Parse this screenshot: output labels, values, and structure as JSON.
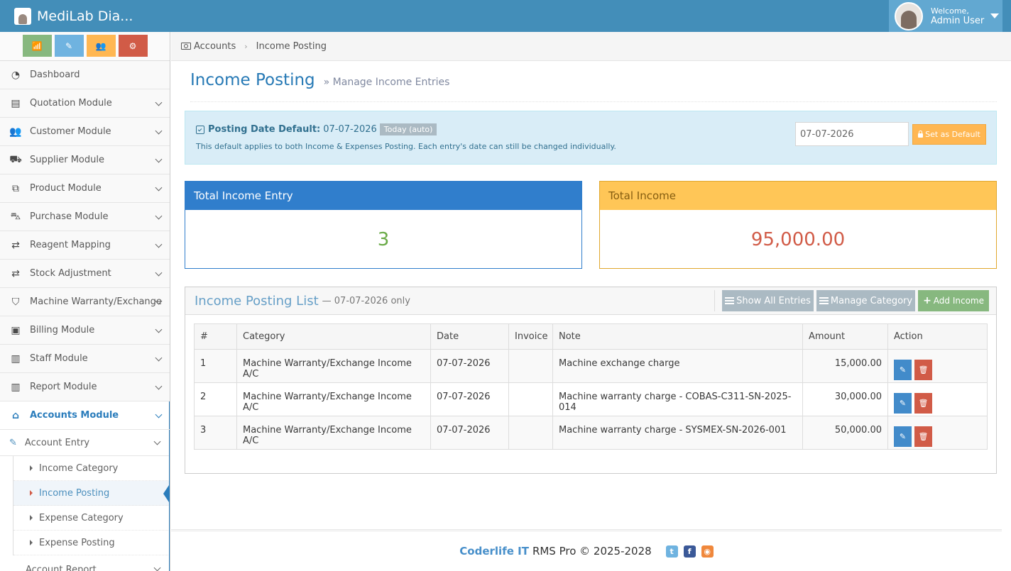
{
  "app": {
    "title": "MediLab Dia..."
  },
  "user": {
    "welcome": "Welcome,",
    "name": "Admin User"
  },
  "shortcuts": [
    {
      "icon": "signal-icon",
      "glyph": "📶"
    },
    {
      "icon": "pencil-icon",
      "glyph": "✎"
    },
    {
      "icon": "users-icon",
      "glyph": "👥"
    },
    {
      "icon": "cogs-icon",
      "glyph": "⚙"
    }
  ],
  "sidebar": {
    "items": [
      {
        "label": "Dashboard",
        "icon": "tachometer-icon",
        "glyph": "◔"
      },
      {
        "label": "Quotation Module",
        "icon": "file-icon",
        "glyph": "▤"
      },
      {
        "label": "Customer Module",
        "icon": "users-icon",
        "glyph": "👥"
      },
      {
        "label": "Supplier Module",
        "icon": "truck-icon",
        "glyph": "⛟"
      },
      {
        "label": "Product Module",
        "icon": "cubes-icon",
        "glyph": "⧉"
      },
      {
        "label": "Purchase Module",
        "icon": "shopping-cart-icon",
        "glyph": "⛍"
      },
      {
        "label": "Reagent Mapping",
        "icon": "exchange-icon",
        "glyph": "⇄"
      },
      {
        "label": "Stock Adjustment",
        "icon": "exchange-icon",
        "glyph": "⇄"
      },
      {
        "label": "Machine Warranty/Exchange",
        "icon": "shield-icon",
        "glyph": "⛉"
      },
      {
        "label": "Billing Module",
        "icon": "money-icon",
        "glyph": "▣"
      },
      {
        "label": "Staff Module",
        "icon": "briefcase-icon",
        "glyph": "▥"
      },
      {
        "label": "Report Module",
        "icon": "bar-chart-icon",
        "glyph": "▥"
      },
      {
        "label": "Accounts Module",
        "icon": "bank-icon",
        "glyph": "⌂"
      }
    ],
    "account_entry": "Account Entry",
    "account_entry_glyph": "✎",
    "sub_items": [
      "Income Category",
      "Income Posting",
      "Expense Category",
      "Expense Posting"
    ],
    "account_report": "Account Report"
  },
  "breadcrumb": {
    "root": "Accounts",
    "sep": "›",
    "current": "Income Posting"
  },
  "page": {
    "title": "Income Posting",
    "subtitle": "» Manage Income Entries"
  },
  "alert": {
    "label": "Posting Date Default:",
    "date": "07-07-2026",
    "badge": "Today (auto)",
    "note": "This default applies to both Income & Expenses Posting. Each entry's date can still be changed individually.",
    "input_value": "07-07-2026",
    "button": "Set as Default"
  },
  "stats": {
    "entry_title": "Total Income Entry",
    "entry_value": "3",
    "income_title": "Total Income",
    "income_value": "95,000.00"
  },
  "list": {
    "title": "Income Posting List",
    "subtitle": "— 07-07-2026 only",
    "show_all": "Show All Entries",
    "manage_category": "Manage Category",
    "add_income": "Add Income",
    "columns": [
      "#",
      "Category",
      "Date",
      "Invoice",
      "Note",
      "Amount",
      "Action"
    ],
    "rows": [
      {
        "no": "1",
        "category": "Machine Warranty/Exchange Income A/C",
        "date": "07-07-2026",
        "invoice": "",
        "note": "Machine exchange charge",
        "amount": "15,000.00"
      },
      {
        "no": "2",
        "category": "Machine Warranty/Exchange Income A/C",
        "date": "07-07-2026",
        "invoice": "",
        "note": "Machine warranty charge - COBAS-C311-SN-2025-014",
        "amount": "30,000.00"
      },
      {
        "no": "3",
        "category": "Machine Warranty/Exchange Income A/C",
        "date": "07-07-2026",
        "invoice": "",
        "note": "Machine warranty charge - SYSMEX-SN-2026-001",
        "amount": "50,000.00"
      }
    ]
  },
  "footer": {
    "brand": "Coderlife IT",
    "text": "RMS Pro © 2025-2028"
  },
  "colors": {
    "navbar": "#438eb9",
    "primary": "#307ecc",
    "warning": "#ffc657",
    "success": "#87b87f",
    "danger": "#d15b47"
  }
}
